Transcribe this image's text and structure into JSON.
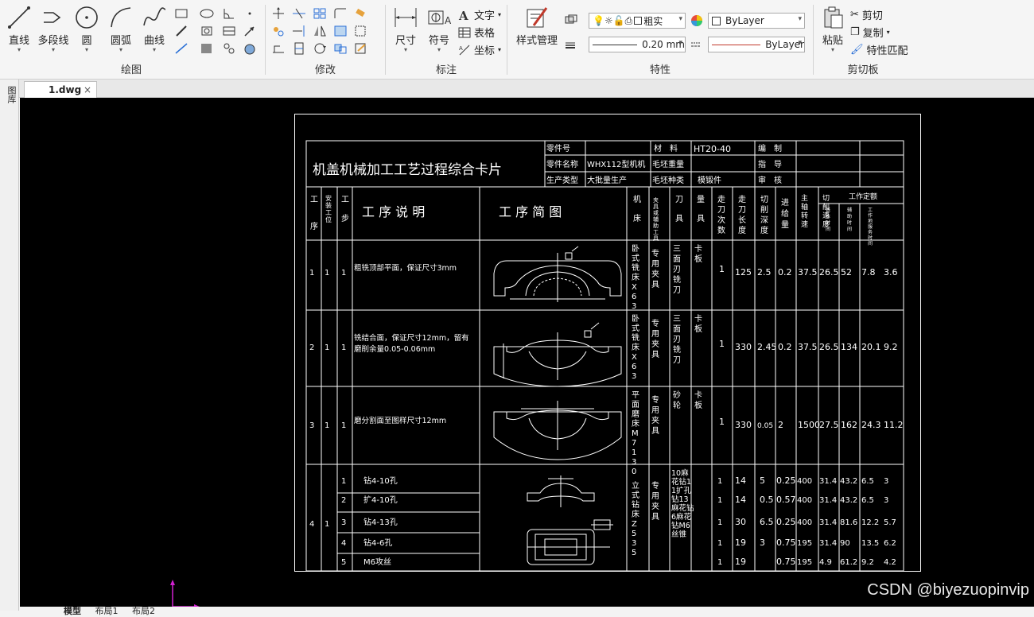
{
  "ribbon": {
    "draw": {
      "title": "绘图",
      "line": "直线",
      "polyline": "多段线",
      "circle": "圆",
      "arc": "圆弧",
      "curve": "曲线"
    },
    "modify": {
      "title": "修改"
    },
    "annotate": {
      "title": "标注",
      "dimension": "尺寸",
      "symbol": "符号",
      "text": "文字",
      "table": "表格",
      "coordinate": "坐标"
    },
    "properties": {
      "title": "特性",
      "style_manager": "样式管理",
      "layer_value": "粗实",
      "color_value": "ByLayer",
      "lineweight_value": "0.20 mm",
      "linetype_value": "ByLayer"
    },
    "clipboard": {
      "title": "剪切板",
      "paste": "粘贴",
      "cut": "剪切",
      "copy": "复制",
      "match": "特性匹配"
    }
  },
  "tabs": {
    "doc": "1.dwg",
    "close": "×"
  },
  "left_strip": {
    "label": "图库"
  },
  "drawing": {
    "title": "机盖机械加工工艺过程综合卡片",
    "header": {
      "part_no_label": "零件号",
      "material_label": "材　料",
      "material_value": "HT20-40",
      "compile_label": "编　制",
      "part_name_label": "零件名称",
      "part_name_value": "WHX112型机机",
      "blank_weight_label": "毛坯重量",
      "guide_label": "指　导",
      "prod_type_label": "生产类型",
      "prod_type_value": "大批量生产",
      "blank_type_label": "毛坯种类",
      "blank_type_value": "模锻件",
      "review_label": "审　核"
    },
    "columns": {
      "op": "工序",
      "install": "安装工位",
      "step": "工步",
      "desc": "工 序 说 明",
      "sketch": "工 序 简 图",
      "machine": "机床",
      "fixture": "夹具或辅助工具",
      "tool": "刀具",
      "gauge": "量具",
      "passes": "走刀次数",
      "length": "走刀长度",
      "depth": "切削深度",
      "feed": "进给量",
      "speed": "主轴转速",
      "cut_speed": "切削速度",
      "quota": "工作定额",
      "basic": "基本时间",
      "aux": "辅助时间",
      "service": "工作地服务时间"
    },
    "rows": [
      {
        "op": "1",
        "install": "1",
        "step": "1",
        "desc": "粗铣顶部平面，保证尺寸3mm",
        "machine": "卧式铣床X63",
        "fixture": "专用夹具",
        "tool": "三面刃铣刀",
        "gauge": "卡板",
        "passes": "1",
        "length": "125",
        "depth": "2.5",
        "feed": "0.2",
        "speed": "37.5",
        "cut": "26.5",
        "basic": "52",
        "aux": "7.8",
        "service": "3.6"
      },
      {
        "op": "2",
        "install": "1",
        "step": "1",
        "desc": "铣结合面，保证尺寸12mm，留有磨削余量0.05-0.06mm",
        "machine": "卧式铣床X63",
        "fixture": "专用夹具",
        "tool": "三面刃铣刀",
        "gauge": "卡板",
        "passes": "1",
        "length": "330",
        "depth": "2.45",
        "feed": "0.2",
        "speed": "37.5",
        "cut": "26.5",
        "basic": "134",
        "aux": "20.1",
        "service": "9.2"
      },
      {
        "op": "3",
        "install": "1",
        "step": "1",
        "desc": "磨分割面至图样尺寸12mm",
        "machine": "平面磨床M7130",
        "fixture": "专用夹具",
        "tool": "砂轮",
        "gauge": "卡板",
        "passes": "1",
        "length": "330",
        "depth": "0.05",
        "feed": "2",
        "speed": "1500",
        "cut": "27.5",
        "basic": "162",
        "aux": "24.3",
        "service": "11.2"
      }
    ],
    "row4": {
      "op": "4",
      "install": "1",
      "machine": "立式钻床Z535",
      "fixture": "专用夹具",
      "tool": "10麻花钻11扩孔钻13麻花钻6麻花钻M6丝锥",
      "steps": [
        {
          "step": "1",
          "desc": "钻4-10孔",
          "passes": "1",
          "length": "14",
          "depth": "5",
          "feed": "0.25",
          "speed": "400",
          "cut": "31.4",
          "basic": "43.2",
          "aux": "6.5",
          "service": "3"
        },
        {
          "step": "2",
          "desc": "扩4-10孔",
          "passes": "1",
          "length": "14",
          "depth": "0.5",
          "feed": "0.57",
          "speed": "400",
          "cut": "31.4",
          "basic": "43.2",
          "aux": "6.5",
          "service": "3"
        },
        {
          "step": "3",
          "desc": "钻4-13孔",
          "passes": "1",
          "length": "30",
          "depth": "6.5",
          "feed": "0.25",
          "speed": "400",
          "cut": "31.4",
          "basic": "81.6",
          "aux": "12.2",
          "service": "5.7"
        },
        {
          "step": "4",
          "desc": "钻4-6孔",
          "passes": "1",
          "length": "19",
          "depth": "3",
          "feed": "0.75",
          "speed": "195",
          "cut": "31.4",
          "basic": "90",
          "aux": "13.5",
          "service": "6.2"
        },
        {
          "step": "5",
          "desc": "M6攻丝",
          "passes": "1",
          "length": "19",
          "depth": "",
          "feed": "0.75",
          "speed": "195",
          "cut": "4.9",
          "basic": "61.2",
          "aux": "9.2",
          "service": "4.2"
        }
      ]
    }
  },
  "bottom_tabs": {
    "model": "模型",
    "layout1": "布局1",
    "layout2": "布局2"
  },
  "watermark": "CSDN @biyezuopinvip"
}
